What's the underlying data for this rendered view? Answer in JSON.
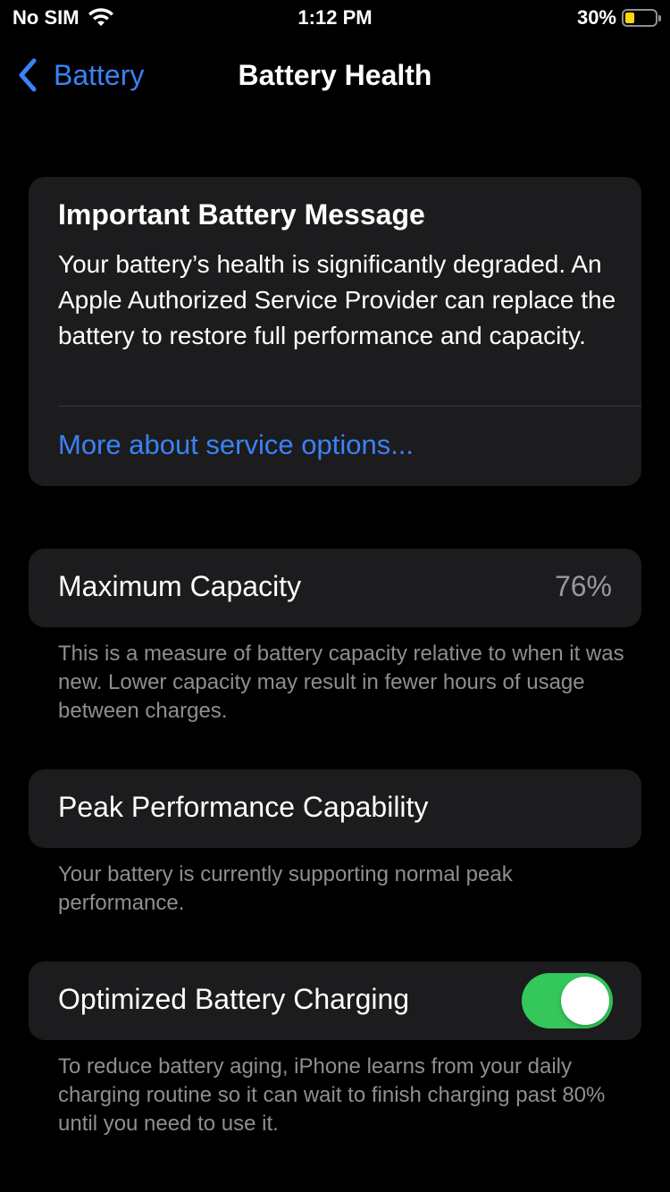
{
  "status_bar": {
    "carrier": "No SIM",
    "time": "1:12 PM",
    "battery_percent": "30%",
    "battery_level": 0.3,
    "icons": [
      "wifi-icon",
      "battery-icon"
    ]
  },
  "nav": {
    "back_label": "Battery",
    "title": "Battery Health",
    "back_icon": "chevron-left-icon"
  },
  "message": {
    "title": "Important Battery Message",
    "body": "Your battery’s health is significantly degraded. An Apple Authorized Service Provider can replace the battery to restore full performance and capacity.",
    "link": "More about service options..."
  },
  "max_capacity": {
    "label": "Maximum Capacity",
    "value": "76%",
    "footnote": "This is a measure of battery capacity relative to when it was new. Lower capacity may result in fewer hours of usage between charges."
  },
  "peak_performance": {
    "label": "Peak Performance Capability",
    "footnote": "Your battery is currently supporting normal peak performance."
  },
  "optimized_charging": {
    "label": "Optimized Battery Charging",
    "enabled": true,
    "footnote": "To reduce battery aging, iPhone learns from your daily charging routine so it can wait to finish charging past 80% until you need to use it."
  },
  "colors": {
    "background": "#000000",
    "card": "#1c1c1e",
    "accent": "#3a82f7",
    "toggle_on": "#34c759",
    "secondary_text": "#8e8e93",
    "battery_fill": "#ffd60a"
  }
}
